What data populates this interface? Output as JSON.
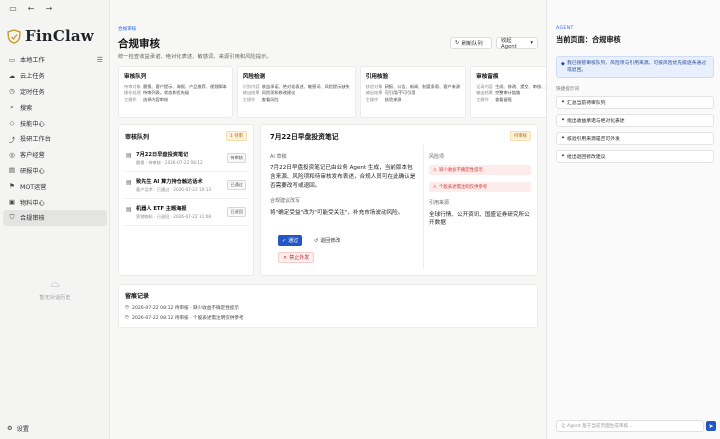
{
  "sidebar": {
    "logo": "FinClaw",
    "items": [
      {
        "icon": "folder-icon",
        "glyph": "▭",
        "label": "本地工作"
      },
      {
        "icon": "cloud-icon",
        "glyph": "☁",
        "label": "云上任务"
      },
      {
        "icon": "clock-icon",
        "glyph": "◷",
        "label": "定时任务"
      },
      {
        "icon": "search-icon",
        "glyph": "⌕",
        "label": "搜索"
      },
      {
        "icon": "skill-icon",
        "glyph": "◇",
        "label": "技能中心"
      },
      {
        "icon": "chart-icon",
        "glyph": "⤴",
        "label": "投研工作台"
      },
      {
        "icon": "customer-icon",
        "glyph": "◎",
        "label": "客户经营"
      },
      {
        "icon": "report-icon",
        "glyph": "▤",
        "label": "研报中心"
      },
      {
        "icon": "mot-icon",
        "glyph": "⚑",
        "label": "MOT运营"
      },
      {
        "icon": "box-icon",
        "glyph": "▣",
        "label": "物料中心"
      },
      {
        "icon": "shield-icon",
        "glyph": "⛉",
        "label": "合规审核"
      }
    ],
    "empty_text": "暂无对话历史",
    "settings_label": "设置"
  },
  "header": {
    "breadcrumb": "合规审核",
    "title": "合规审核",
    "subtitle": "统一检查收益承诺、绝对化表述、敏感词、来源引用和风险提示。",
    "refresh_label": "刷新队列",
    "agent_label": "收起 Agent"
  },
  "cards": [
    {
      "title": "审核队列",
      "rows": [
        [
          "待审对象",
          "晨报、客户提示、海报、产品推荐、视频脚本"
        ],
        [
          "操作处理",
          "待审列表，状态和优先级"
        ],
        [
          "主操作",
          "选择内容审核"
        ]
      ]
    },
    {
      "title": "风险检测",
      "rows": [
        [
          "识别内容",
          "收益承诺、绝对化表述、敏感词、风险提示缺失"
        ],
        [
          "输出结果",
          "风险项和修改建议"
        ],
        [
          "主操作",
          "查看风险"
        ]
      ]
    },
    {
      "title": "引用核验",
      "rows": [
        [
          "核验对象",
          "研报、公告、新闻、制度条款、客户来源"
        ],
        [
          "输出结果",
          "可引用/不可引用"
        ],
        [
          "主操作",
          "核验来源"
        ]
      ]
    },
    {
      "title": "审核留痕",
      "rows": [
        [
          "记录内容",
          "生成、修改、提交、审核、通过、退回、禁止外发"
        ],
        [
          "输出结果",
          "完整审计链路"
        ],
        [
          "主操作",
          "查看留痕"
        ]
      ]
    }
  ],
  "queue": {
    "title": "审核队列",
    "count_badge": "1 待审",
    "items": [
      {
        "name": "7月22日早盘投资笔记",
        "meta": "晨报 · 待审核 · 2026-07-22 08:12",
        "status": "待审核"
      },
      {
        "name": "致先生 AI 算力持仓触达话术",
        "meta": "客户话术 · 已通过 · 2026-07-22 10:13",
        "status": "已通过"
      },
      {
        "name": "机器人 ETF 主题海报",
        "meta": "营销物料 · 已退回 · 2026-07-22 11:08",
        "status": "已退回"
      }
    ]
  },
  "detail": {
    "title": "7月22日早盘投资笔记",
    "status_badge": "待审核",
    "draft_label": "AI 草稿",
    "draft_text": "7月22日早盘投资笔记已由业务 Agent 生成，当前版本包含来源、风险项和待审核发布表述，合规人员可在此确认是否需要改写或退回。",
    "suggest_label": "合规建议改写",
    "suggest_text": "将\"确定受益\"改为\"可能受关注\"，补充市场波动风险。",
    "risk_label": "风险项",
    "risks": [
      "缺少收益不确定性提示",
      "个股表述需注明仅供参考"
    ],
    "source_label": "引用来源",
    "source_text": "全球行情、公开资讯、国盛证券研究所公开数据",
    "pass_label": "通过",
    "back_label": "退回修改",
    "stop_label": "禁止外发"
  },
  "log": {
    "title": "留痕记录",
    "rows": [
      "2026-07-22 08:12 待审核 · 缺少收益不确定性提示",
      "2026-07-22 08:12 待审核 · 个股表述需注明仅供参考"
    ]
  },
  "agent": {
    "tag": "AGENT",
    "title": "当前页面：合规审核",
    "notice": "我已接管审核队列、风险项与引用来源。可按风险优先级逐条通过或退回。",
    "suggest_label": "快捷提示词",
    "suggestions": [
      "汇总当前待审队列",
      "指出收益承诺与绝对化表述",
      "核验引用来源是否可外发",
      "给出退回修改建议"
    ],
    "input_placeholder": "让 Agent 基于当前页面生成审核..."
  },
  "colors": {
    "accent": "#2457c5",
    "risk": "#d23a3a",
    "pending": "#b36b00"
  }
}
